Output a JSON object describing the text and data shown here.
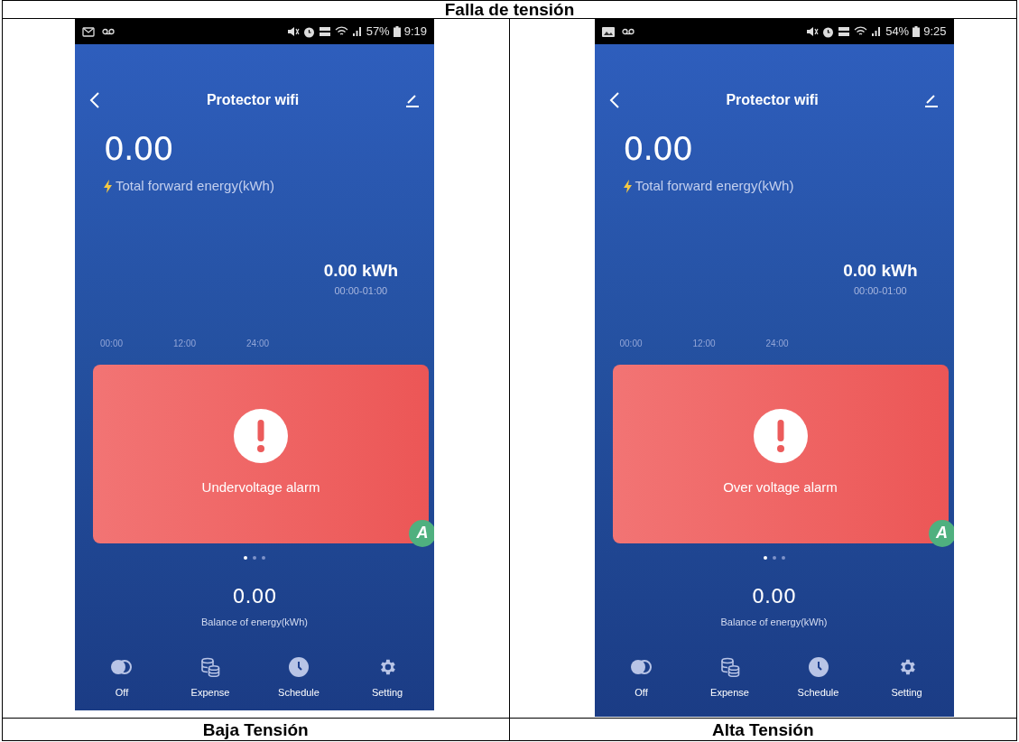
{
  "table_title": "Falla de tensión",
  "screens": [
    {
      "status_bar": {
        "notification_icons": [
          {
            "kind": "mail"
          },
          {
            "kind": "voicemail"
          }
        ],
        "battery": "57%",
        "time": "9:19"
      },
      "title": "Protector wifi",
      "total_value": "0.00",
      "total_label": "Total forward energy(kWh)",
      "hour_value": "0.00",
      "hour_unit": "kWh",
      "hour_range": "00:00-01:00",
      "axis_labels": [
        "00:00",
        "12:00",
        "24:00"
      ],
      "alarm": "Undervoltage alarm",
      "badge": "A",
      "dots": [
        {
          "selected": true
        },
        {
          "selected": false
        },
        {
          "selected": false
        }
      ],
      "balance_value": "0.00",
      "balance_label": "Balance of energy(kWh)",
      "nav": [
        {
          "kind": "toggle",
          "label": "Off"
        },
        {
          "kind": "coins",
          "label": "Expense"
        },
        {
          "kind": "clock",
          "label": "Schedule"
        },
        {
          "kind": "gear",
          "label": "Setting"
        }
      ],
      "caption": "Baja Tensión"
    },
    {
      "status_bar": {
        "notification_icons": [
          {
            "kind": "image"
          },
          {
            "kind": "voicemail"
          }
        ],
        "battery": "54%",
        "time": "9:25"
      },
      "title": "Protector wifi",
      "total_value": "0.00",
      "total_label": "Total forward energy(kWh)",
      "hour_value": "0.00",
      "hour_unit": "kWh",
      "hour_range": "00:00-01:00",
      "axis_labels": [
        "00:00",
        "12:00",
        "24:00"
      ],
      "alarm": "Over voltage alarm",
      "badge": "A",
      "dots": [
        {
          "selected": true
        },
        {
          "selected": false
        },
        {
          "selected": false
        }
      ],
      "balance_value": "0.00",
      "balance_label": "Balance of energy(kWh)",
      "nav": [
        {
          "kind": "toggle",
          "label": "Off"
        },
        {
          "kind": "coins",
          "label": "Expense"
        },
        {
          "kind": "clock",
          "label": "Schedule"
        },
        {
          "kind": "gear",
          "label": "Setting"
        }
      ],
      "caption": "Alta Tensión"
    }
  ]
}
